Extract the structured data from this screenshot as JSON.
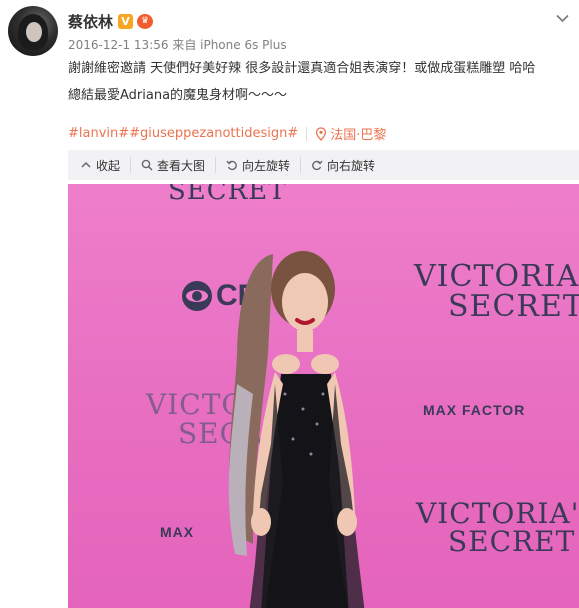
{
  "post": {
    "username": "蔡依林",
    "verified_badge": "V",
    "vip_badge": "♛",
    "meta": "2016-12-1 13:56 来自 iPhone 6s Plus",
    "text_line1": "謝謝維密邀請  天使們好美好辣 很多設計還真適合姐表演穿！或做成蛋糕雕塑 哈哈",
    "text_line2": "總結最愛Adriana的魔鬼身材啊～～～",
    "hashtags": "#lanvin##giuseppezanottidesign#",
    "location": "法国·巴黎"
  },
  "toolbar": {
    "collapse": "收起",
    "view_large": "查看大图",
    "rotate_left": "向左旋转",
    "rotate_right": "向右旋转"
  },
  "photo": {
    "brand_top": "SECRET",
    "brand_right_1": "VICTORIA",
    "brand_right_2": "SECRET",
    "brand_mid_1": "VICTO",
    "brand_mid_2": "SECR",
    "brand_bottom_1": "VICTORIA'",
    "brand_bottom_2": "SECRET",
    "max_factor": "MAX FACTOR",
    "max_factor_short": "MAX",
    "cbs": "CE"
  },
  "colors": {
    "accent": "#eb7350",
    "backdrop": "#e86fc2",
    "verified": "#f6a623"
  },
  "icons": [
    "dropdown-chevron-icon",
    "collapse-icon",
    "zoom-icon",
    "rotate-left-icon",
    "rotate-right-icon",
    "location-pin-icon"
  ]
}
